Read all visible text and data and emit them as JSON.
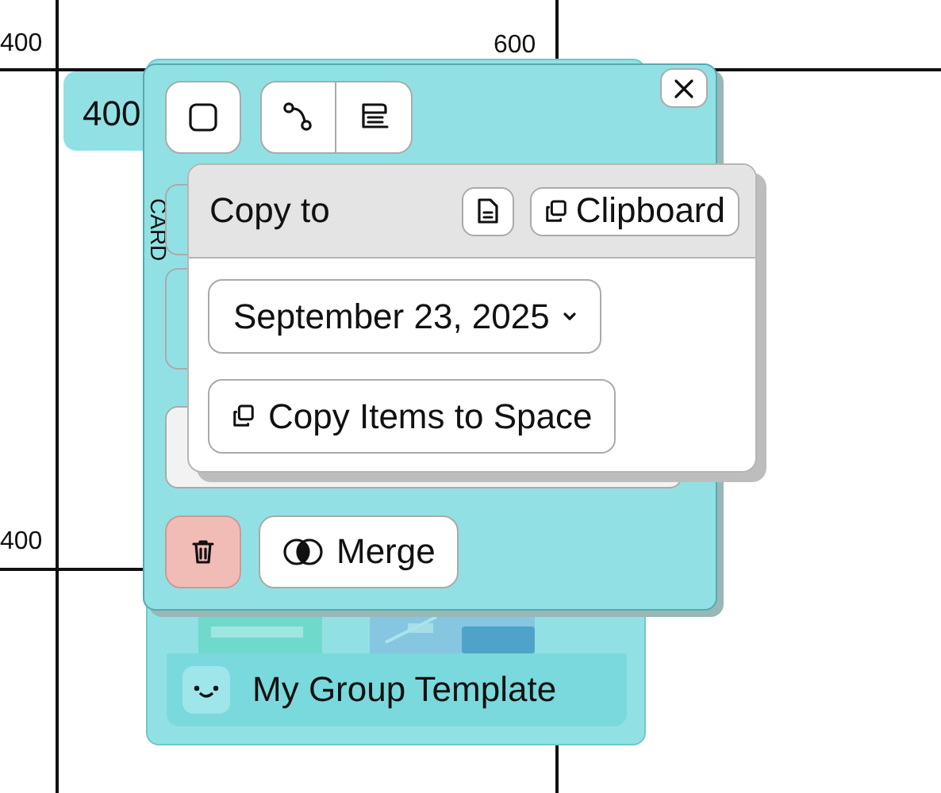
{
  "canvas": {
    "axis_labels": [
      {
        "kind": "top-left",
        "text": "400"
      },
      {
        "kind": "top-right",
        "text": "600"
      },
      {
        "kind": "bottom-left",
        "text": "400"
      }
    ],
    "frame_label": "400"
  },
  "group": {
    "title": "My Group Template"
  },
  "panel": {
    "tools": [
      {
        "kind": "square"
      },
      {
        "kind": "connector"
      },
      {
        "kind": "note"
      }
    ],
    "side_label": "CARD",
    "actions": [
      {
        "kind": "delete"
      },
      {
        "kind": "merge",
        "label": "Merge"
      }
    ]
  },
  "popover": {
    "title": "Copy to",
    "header_buttons": [
      {
        "kind": "document"
      },
      {
        "kind": "clipboard",
        "label": "Clipboard"
      }
    ],
    "date": "September 23, 2025",
    "copy_button": "Copy Items to Space"
  }
}
